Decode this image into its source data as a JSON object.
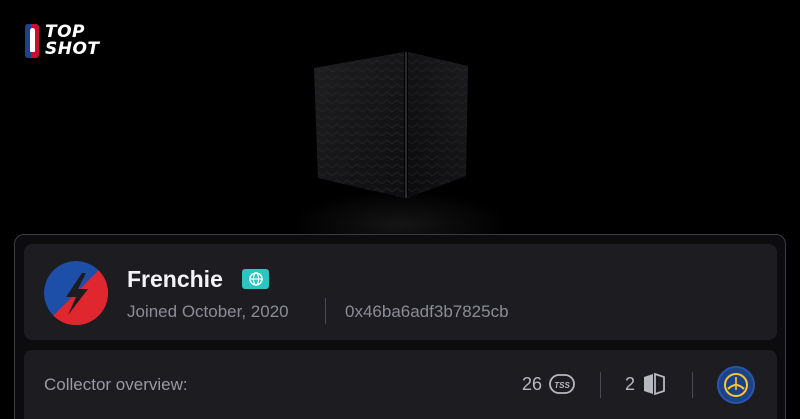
{
  "header": {
    "logo_line1": "TOP",
    "logo_line2": "SHOT",
    "logo_icon": "nba-logo-icon"
  },
  "hero": {
    "image": "display-case-cube"
  },
  "profile": {
    "username": "Frenchie",
    "badge_icon": "globe-icon",
    "joined": "Joined October, 2020",
    "address": "0x46ba6adf3b7825cb",
    "avatar_colors": {
      "red": "#e0262f",
      "blue": "#1e4fa8"
    }
  },
  "overview": {
    "label": "Collector overview:",
    "moments_count": "26",
    "moments_icon": "tss-icon",
    "packs_count": "2",
    "packs_icon": "pack-icon",
    "team_icon": "golden-state-warriors-logo"
  },
  "colors": {
    "background": "#000000",
    "card": "#1c1c21",
    "accent_badge": "#2ec4c4",
    "muted_text": "#8c8c96"
  }
}
